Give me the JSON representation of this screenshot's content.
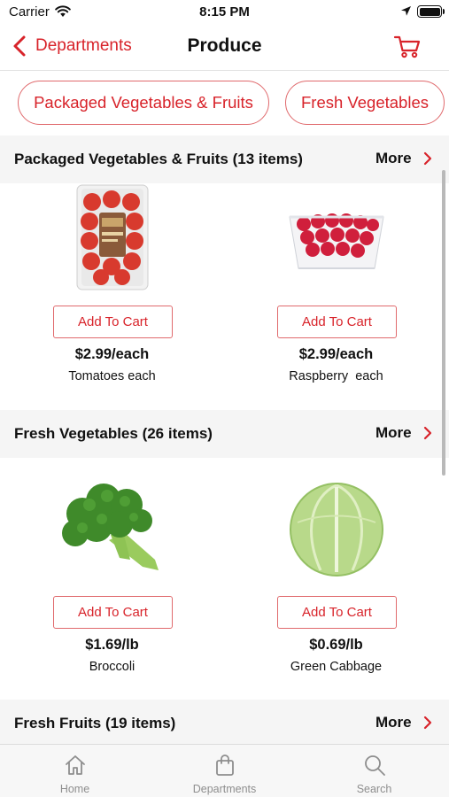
{
  "status_bar": {
    "carrier": "Carrier",
    "time": "8:15 PM"
  },
  "nav": {
    "back_label": "Departments",
    "title": "Produce",
    "cart_icon": "cart-icon"
  },
  "chips": [
    "Packaged Vegetables & Fruits",
    "Fresh Vegetables"
  ],
  "sections": [
    {
      "title": "Packaged Vegetables & Fruits (13 items)",
      "more_label": "More",
      "products": [
        {
          "name": "Tomatoes each",
          "price": "$2.99/each",
          "button": "Add To Cart"
        },
        {
          "name": "Raspberry  each",
          "price": "$2.99/each",
          "button": "Add To Cart"
        }
      ]
    },
    {
      "title": "Fresh Vegetables (26 items)",
      "more_label": "More",
      "products": [
        {
          "name": "Broccoli",
          "price": "$1.69/lb",
          "button": "Add To Cart"
        },
        {
          "name": "Green Cabbage",
          "price": "$0.69/lb",
          "button": "Add To Cart"
        }
      ]
    },
    {
      "title": "Fresh Fruits (19 items)",
      "more_label": "More",
      "products": []
    }
  ],
  "tabs": [
    {
      "label": "Home",
      "icon": "home-icon"
    },
    {
      "label": "Departments",
      "icon": "shopping-bag-icon"
    },
    {
      "label": "Search",
      "icon": "search-icon"
    }
  ],
  "colors": {
    "accent": "#d8232a",
    "header_bg": "#f5f5f5",
    "tab_inactive": "#8e8e8e"
  }
}
